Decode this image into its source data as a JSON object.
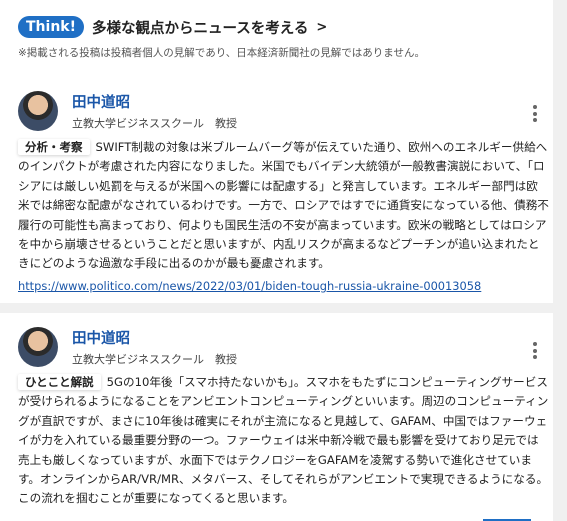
{
  "think": {
    "badge": "Think!",
    "title": "多様な観点からニュースを考える",
    "disclaimer": "※掲載される投稿は投稿者個人の見解であり、日本経済新聞社の見解ではありません。"
  },
  "comments": [
    {
      "author": "田中道昭",
      "affiliation": "立教大学ビジネススクール　教授",
      "tag": "分析・考察",
      "text": "SWIFT制裁の対象は米ブルームバーグ等が伝えていた通り、欧州へのエネルギー供給へのインパクトが考慮された内容になりました。米国でもバイデン大統領が一般教書演説において、「ロシアには厳しい処罰を与えるが米国への影響には配慮する」と発言しています。エネルギー部門は欧米では綿密な配慮がなされているわけです。一方で、ロシアではすでに通貨安になっている他、債務不履行の可能性も高まっており、何よりも国民生活の不安が高まっています。欧米の戦略としてはロシアを中から崩壊させるということだと思いますが、内乱リスクが高まるなどプーチンが追い込まれたときにどのような過激な手段に出るのかが最も憂慮されます。",
      "link": "https://www.politico.com/news/2022/03/01/biden-tough-russia-ukraine-00013058"
    },
    {
      "author": "田中道昭",
      "affiliation": "立教大学ビジネススクール　教授",
      "tag": "ひとこと解説",
      "text": "5Gの10年後「スマホ持たないかも」。スマホをもたずにコンピューティングサービスが受けられるようになることをアンビエントコンピューティングといいます。周辺のコンピューティングが直訳ですが、まさに10年後は確実にそれが主流になると見越して、GAFAM、中国ではファーウェイが力を入れている最重要分野の一つ。ファーウェイは米中新冷戦で最も影響を受けており足元では売上も厳しくなっていますが、水面下ではテクノロジーをGAFAMを凌駕する勢いで進化させています。オンラインからAR/VR/MR、メタバース、そしてそれらがアンビエントで実現できるようになる。この流れを掴むことが重要になってくると思います。"
    }
  ]
}
